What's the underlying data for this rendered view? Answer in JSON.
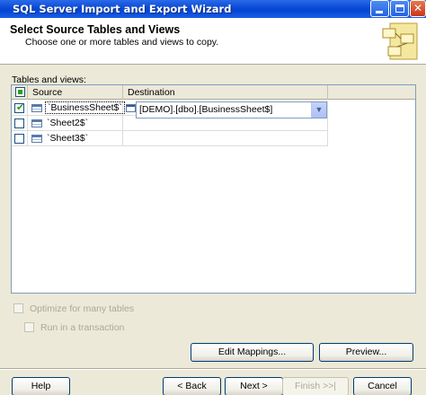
{
  "window": {
    "title": "SQL Server Import and Export Wizard"
  },
  "header": {
    "title": "Select Source Tables and Views",
    "subtitle": "Choose one or more tables and views to copy."
  },
  "tables_label": "Tables and views:",
  "grid": {
    "columns": [
      "Source",
      "Destination"
    ],
    "rows": [
      {
        "checked": true,
        "source": "`BusinessSheet$`",
        "destination": "[DEMO].[dbo].[BusinessSheet$]"
      },
      {
        "checked": false,
        "source": "`Sheet2$`",
        "destination": ""
      },
      {
        "checked": false,
        "source": "`Sheet3$`",
        "destination": ""
      }
    ]
  },
  "options": {
    "optimize_label": "Optimize for many tables",
    "transaction_label": "Run in a transaction"
  },
  "buttons": {
    "edit_mappings": "Edit Mappings...",
    "preview": "Preview...",
    "help": "Help",
    "back": "< Back",
    "next": "Next >",
    "finish": "Finish >>|",
    "cancel": "Cancel"
  },
  "colors": {
    "titlebar": "#0a48d8",
    "window_bg": "#ece9d8",
    "check_green": "#21a121"
  }
}
